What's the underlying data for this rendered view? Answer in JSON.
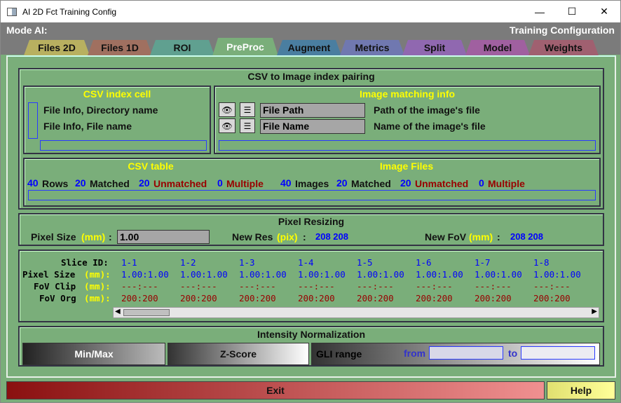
{
  "window": {
    "title": "AI 2D Fct Training Config",
    "minimize": "—",
    "maximize": "☐",
    "close": "✕"
  },
  "header": {
    "mode": "Mode AI:",
    "config": "Training Configuration"
  },
  "tabs": [
    {
      "label": "Files 2D",
      "color": "#b8b060"
    },
    {
      "label": "Files 1D",
      "color": "#a07060"
    },
    {
      "label": "ROI",
      "color": "#60a090"
    },
    {
      "label": "PreProc",
      "color": "#7aae7a"
    },
    {
      "label": "Augment",
      "color": "#4a7ea0"
    },
    {
      "label": "Metrics",
      "color": "#7078b0"
    },
    {
      "label": "Split",
      "color": "#9068b0"
    },
    {
      "label": "Model",
      "color": "#a060a0"
    },
    {
      "label": "Weights",
      "color": "#a06070"
    }
  ],
  "csv_pairing": {
    "title": "CSV to Image index pairing",
    "csv_index_cell": {
      "title": "CSV index cell",
      "items": [
        "File Info, Directory name",
        "File Info, File name"
      ]
    },
    "image_matching": {
      "title": "Image matching info",
      "rows": [
        {
          "field": "File Path",
          "desc": "Path of the image's file"
        },
        {
          "field": "File Name",
          "desc": "Name of the image's file"
        }
      ]
    },
    "csv_table": {
      "title": "CSV table",
      "rows": "40",
      "rows_label": "Rows",
      "matched": "20",
      "matched_label": "Matched",
      "unmatched": "20",
      "unmatched_label": "Unmatched",
      "multiple": "0",
      "multiple_label": "Multiple"
    },
    "image_files": {
      "title": "Image Files",
      "images": "40",
      "images_label": "Images",
      "matched": "20",
      "matched_label": "Matched",
      "unmatched": "20",
      "unmatched_label": "Unmatched",
      "multiple": "0",
      "multiple_label": "Multiple"
    }
  },
  "pixel_resizing": {
    "title": "Pixel Resizing",
    "pixel_size_label": "Pixel Size",
    "pixel_size_unit": "(mm)",
    "colon": ":",
    "pixel_size_value": "1.00",
    "new_res_label": "New Res",
    "new_res_unit": "(pix)",
    "new_res_value": "208 208",
    "new_fov_label": "New FoV",
    "new_fov_unit": "(mm)",
    "new_fov_value": "208 208"
  },
  "slices": {
    "labels": {
      "slice_id": "Slice ID:",
      "pixel_size": "Pixel Size",
      "fov_clip": "FoV Clip",
      "fov_org": "FoV Org",
      "unit": "(mm):"
    },
    "ids": [
      "1-1",
      "1-2",
      "1-3",
      "1-4",
      "1-5",
      "1-6",
      "1-7",
      "1-8"
    ],
    "pixel_size": "1.00:1.00",
    "fov_clip": "---:---",
    "fov_org": "200:200"
  },
  "intensity": {
    "title": "Intensity Normalization",
    "minmax": "Min/Max",
    "zscore": "Z-Score",
    "gli": "GLI range",
    "from": "from",
    "to": "to"
  },
  "footer": {
    "exit": "Exit",
    "help": "Help"
  }
}
